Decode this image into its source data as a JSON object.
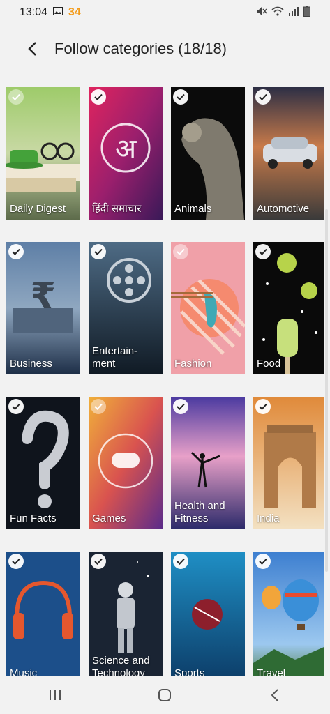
{
  "status": {
    "time": "13:04",
    "badge": "34",
    "icons": [
      "image-icon",
      "mute-icon",
      "wifi-icon",
      "signal-icon",
      "battery-icon"
    ]
  },
  "header": {
    "back_icon": "chevron-left-icon",
    "title": "Follow categories (18/18)"
  },
  "categories": [
    {
      "label": "Daily Digest",
      "checked": true
    },
    {
      "label": "हिंदी समाचार",
      "checked": true
    },
    {
      "label": "Animals",
      "checked": true
    },
    {
      "label": "Automotive",
      "checked": true
    },
    {
      "label": "Business",
      "checked": true
    },
    {
      "label": "Entertain-\nment",
      "checked": true
    },
    {
      "label": "Fashion",
      "checked": true
    },
    {
      "label": "Food",
      "checked": true
    },
    {
      "label": "Fun Facts",
      "checked": true
    },
    {
      "label": "Games",
      "checked": true
    },
    {
      "label": "Health and\nFitness",
      "checked": true
    },
    {
      "label": "India",
      "checked": true
    },
    {
      "label": "Music",
      "checked": true
    },
    {
      "label": "Science and\nTechnology",
      "checked": true
    },
    {
      "label": "Sports",
      "checked": true
    },
    {
      "label": "Travel",
      "checked": true
    }
  ],
  "navbar": {
    "icons": [
      "recent-apps-icon",
      "home-icon",
      "back-icon"
    ]
  }
}
